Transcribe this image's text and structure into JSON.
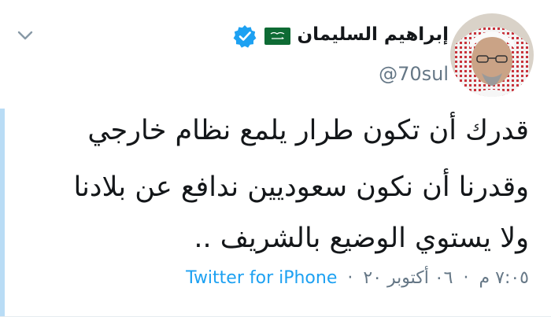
{
  "user": {
    "display_name": "إبراهيم السليمان",
    "handle": "@70sul",
    "verified": true,
    "flag_icon": "saudi-flag-icon",
    "avatar_icon": "profile-photo"
  },
  "tweet": {
    "lines": [
      "قدرك أن تكون طرار يلمع نظام خارجي",
      "وقدرنا أن نكون سعوديين ندافع عن بلادنا",
      "ولا يستوي الوضيع بالشريف .."
    ]
  },
  "meta": {
    "time": "٧:٠٥ م",
    "separator": "·",
    "date": "٠٦ أكتوبر ٢٠",
    "source": "Twitter for iPhone"
  },
  "colors": {
    "link": "#1da1f2",
    "muted": "#657786",
    "text": "#14171a",
    "verified_badge": "#1da1f2",
    "flag_green": "#0e6b34"
  }
}
